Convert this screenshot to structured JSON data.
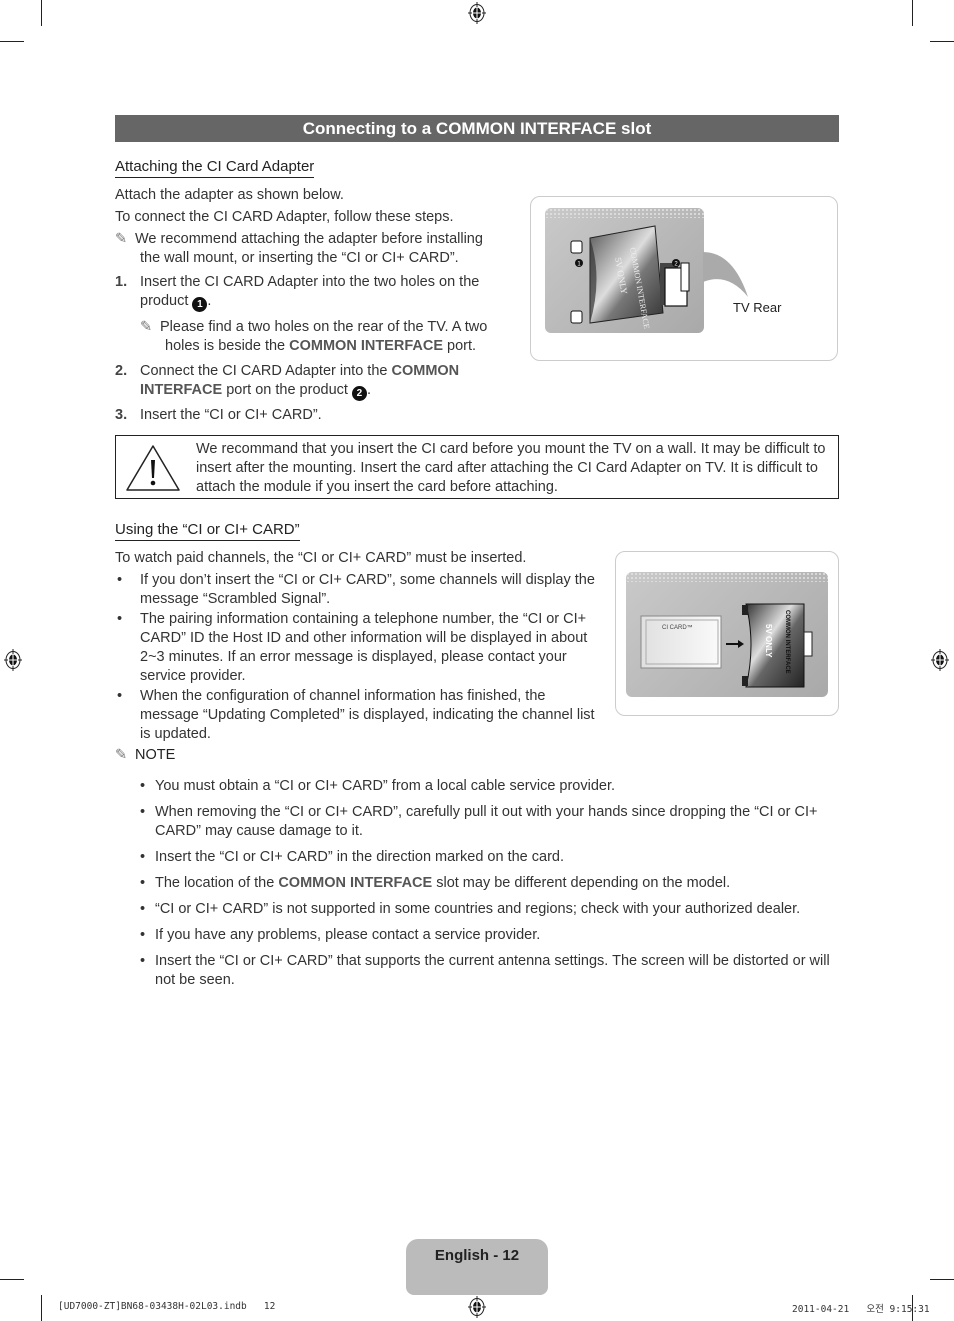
{
  "header": {
    "title": "Connecting to a COMMON INTERFACE slot"
  },
  "section1": {
    "heading": "Attaching the CI Card Adapter",
    "intro1": "Attach the adapter as shown below.",
    "intro2": "To connect the CI CARD Adapter, follow these steps.",
    "note1_line1": "We recommend attaching the adapter before installing",
    "note1_line2": "the wall mount, or inserting the “CI or CI+ CARD”.",
    "steps": [
      {
        "num": "1.",
        "line1": "Insert the CI CARD Adapter into the two holes on the",
        "line2": "product",
        "marker": "1",
        "subnote_line1": "Please find a two holes on the rear of the TV. A two",
        "subnote_line2_pre": "holes is beside the ",
        "subnote_bold": "COMMON INTERFACE",
        "subnote_line2_post": " port."
      },
      {
        "num": "2.",
        "line1_pre": "Connect the CI CARD Adapter into the ",
        "line1_bold": "COMMON",
        "line2_bold": "INTERFACE",
        "line2_post": " port on the product",
        "marker": "2"
      },
      {
        "num": "3.",
        "text": "Insert the “CI or CI+ CARD”."
      }
    ],
    "figure": {
      "caption": "TV Rear",
      "label_common": "COMMON INTERFACE",
      "label_5v": "5V ONLY",
      "marker1": "1",
      "marker2": "2"
    }
  },
  "warning": {
    "icon": "warning-triangle-icon",
    "text": "We recommand that you insert the CI card before you mount the TV on a wall. It may be difficult to insert after the mounting. Insert the card after attaching the CI Card Adapter on TV. It is difficult to attach the module if you insert the card before attaching."
  },
  "section2": {
    "heading": "Using the “CI or CI+ CARD”",
    "intro": "To watch paid channels, the “CI or CI+ CARD” must be inserted.",
    "bullets": [
      "If you don’t insert the “CI or CI+ CARD”, some channels will display the message “Scrambled Signal”.",
      "The pairing information containing a telephone number, the “CI or CI+ CARD” ID the Host ID and other information will be displayed in about 2~3 minutes. If an error message is displayed, please contact your service provider.",
      "When the configuration of channel information has finished, the message “Updating Completed” is displayed, indicating the channel list is updated."
    ],
    "note_label": "NOTE",
    "notes": [
      {
        "text": "You must obtain a “CI or CI+ CARD” from a local cable service provider."
      },
      {
        "text": "When removing the “CI or CI+ CARD”, carefully pull it out with your hands since dropping the “CI or CI+ CARD” may cause damage to it."
      },
      {
        "text": "Insert the “CI or CI+ CARD” in the direction marked on the card."
      },
      {
        "pre": "The location of the ",
        "bold": "COMMON INTERFACE",
        "post": " slot may be different depending on the model."
      },
      {
        "text": "“CI or CI+ CARD” is not supported in some countries and regions; check with your authorized dealer."
      },
      {
        "text": "If you have any problems, please contact a service provider."
      },
      {
        "text": "Insert the “CI or CI+ CARD” that supports the current antenna settings. The screen will be distorted or will not be seen."
      }
    ],
    "figure": {
      "card_label": "CI CARD™",
      "label_common": "COMMON INTERFACE",
      "label_5v": "5V ONLY"
    }
  },
  "footer": {
    "page_label": "English - 12",
    "slug_left": "[UD7000-ZT]BN68-03438H-02L03.indb   12",
    "slug_right": "2011-04-21   오전 9:15:31"
  }
}
